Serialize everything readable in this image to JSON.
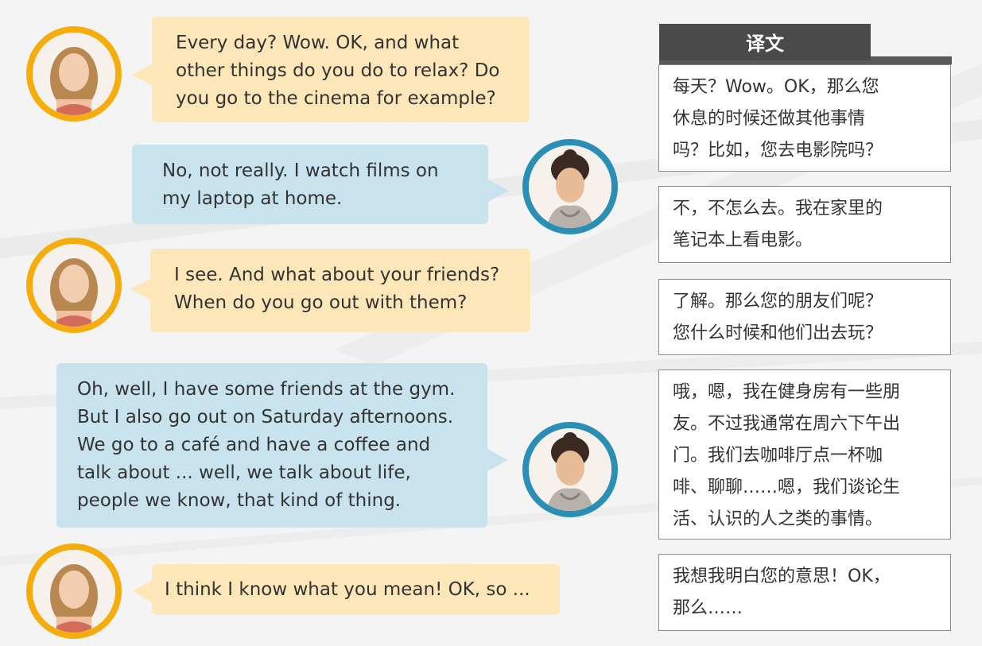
{
  "translation_header": "译文",
  "dialogue": [
    {
      "speaker": "a",
      "lines": [
        "Every day? Wow. OK, and what",
        "other things do you do to relax? Do",
        "you go to the cinema for example?"
      ],
      "translation": [
        "每天？Wow。OK，那么您",
        "休息的时候还做其他事情",
        "吗？比如，您去电影院吗？"
      ]
    },
    {
      "speaker": "b",
      "lines": [
        "No, not really. I watch films on",
        "my laptop at home."
      ],
      "translation": [
        "不，不怎么去。我在家里的",
        "笔记本上看电影。"
      ]
    },
    {
      "speaker": "a",
      "lines": [
        "I see. And what about your friends?",
        "When do you go out with them?"
      ],
      "translation": [
        "了解。那么您的朋友们呢？",
        "您什么时候和他们出去玩？"
      ]
    },
    {
      "speaker": "b",
      "lines": [
        "Oh, well, I have some friends at the gym.",
        "But I also go out on Saturday afternoons.",
        "We go to a café and have a coffee and",
        "talk about ... well, we talk about life,",
        "people we know, that kind of thing."
      ],
      "translation": [
        "哦，嗯，我在健身房有一些朋",
        "友。不过我通常在周六下午出",
        "门。我们去咖啡厅点一杯咖",
        "啡、聊聊……嗯，我们谈论生",
        "活、认识的人之类的事情。"
      ]
    },
    {
      "speaker": "a",
      "lines": [
        "I think I know what you mean! OK, so ..."
      ],
      "translation": [
        "我想我明白您的意思！OK，",
        "那么……"
      ]
    }
  ],
  "colors": {
    "speaker_a_ring": "#f5ad0e",
    "speaker_a_bubble": "#fde7b8",
    "speaker_b_ring": "#2b8fb5",
    "speaker_b_bubble": "#c8e3ee",
    "header_bg": "#4a4a4a"
  }
}
